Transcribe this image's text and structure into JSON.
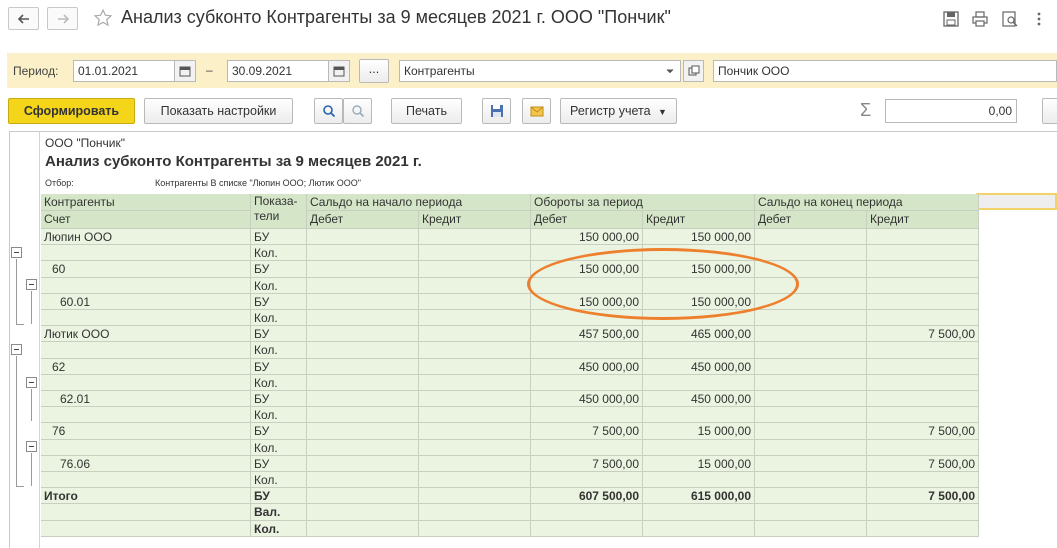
{
  "window": {
    "title": "Анализ субконто Контрагенты за 9 месяцев 2021 г. ООО \"Пончик\""
  },
  "params": {
    "period_label": "Период:",
    "date_from": "01.01.2021",
    "dash": "–",
    "date_to": "30.09.2021",
    "ellipsis": "...",
    "subconto_type": "Контрагенты",
    "organization": "Пончик ООО"
  },
  "toolbar": {
    "generate": "Сформировать",
    "show_settings": "Показать настройки",
    "print": "Печать",
    "register": "Регистр учета",
    "sum_symbol": "Σ",
    "sum_value": "0,00"
  },
  "report": {
    "org": "ООО \"Пончик\"",
    "title": "Анализ субконто Контрагенты за 9 месяцев 2021 г.",
    "filter_label": "Отбор:",
    "filter_value": "Контрагенты В списке \"Люпин ООО; Лютик ООО\"",
    "headers": {
      "contractors": "Контрагенты",
      "account": "Счет",
      "indicators": "Показа-\nтели",
      "opening": "Сальдо на начало периода",
      "turnover": "Обороты за период",
      "closing": "Сальдо на конец периода",
      "debit": "Дебет",
      "credit": "Кредит"
    },
    "rows": [
      {
        "name": "Люпин ООО",
        "ind": "БУ",
        "od": "",
        "oc": "",
        "td": "150 000,00",
        "tc": "150 000,00",
        "cd": "",
        "cc": ""
      },
      {
        "name": "",
        "ind": "Кол.",
        "od": "",
        "oc": "",
        "td": "",
        "tc": "",
        "cd": "",
        "cc": ""
      },
      {
        "name": "60",
        "ind": "БУ",
        "od": "",
        "oc": "",
        "td": "150 000,00",
        "tc": "150 000,00",
        "cd": "",
        "cc": ""
      },
      {
        "name": "",
        "ind": "Кол.",
        "od": "",
        "oc": "",
        "td": "",
        "tc": "",
        "cd": "",
        "cc": ""
      },
      {
        "name": "60.01",
        "ind": "БУ",
        "od": "",
        "oc": "",
        "td": "150 000,00",
        "tc": "150 000,00",
        "cd": "",
        "cc": ""
      },
      {
        "name": "",
        "ind": "Кол.",
        "od": "",
        "oc": "",
        "td": "",
        "tc": "",
        "cd": "",
        "cc": ""
      },
      {
        "name": "Лютик ООО",
        "ind": "БУ",
        "od": "",
        "oc": "",
        "td": "457 500,00",
        "tc": "465 000,00",
        "cd": "",
        "cc": "7 500,00"
      },
      {
        "name": "",
        "ind": "Кол.",
        "od": "",
        "oc": "",
        "td": "",
        "tc": "",
        "cd": "",
        "cc": ""
      },
      {
        "name": "62",
        "ind": "БУ",
        "od": "",
        "oc": "",
        "td": "450 000,00",
        "tc": "450 000,00",
        "cd": "",
        "cc": ""
      },
      {
        "name": "",
        "ind": "Кол.",
        "od": "",
        "oc": "",
        "td": "",
        "tc": "",
        "cd": "",
        "cc": ""
      },
      {
        "name": "62.01",
        "ind": "БУ",
        "od": "",
        "oc": "",
        "td": "450 000,00",
        "tc": "450 000,00",
        "cd": "",
        "cc": ""
      },
      {
        "name": "",
        "ind": "Кол.",
        "od": "",
        "oc": "",
        "td": "",
        "tc": "",
        "cd": "",
        "cc": ""
      },
      {
        "name": "76",
        "ind": "БУ",
        "od": "",
        "oc": "",
        "td": "7 500,00",
        "tc": "15 000,00",
        "cd": "",
        "cc": "7 500,00"
      },
      {
        "name": "",
        "ind": "Кол.",
        "od": "",
        "oc": "",
        "td": "",
        "tc": "",
        "cd": "",
        "cc": ""
      },
      {
        "name": "76.06",
        "ind": "БУ",
        "od": "",
        "oc": "",
        "td": "7 500,00",
        "tc": "15 000,00",
        "cd": "",
        "cc": "7 500,00"
      },
      {
        "name": "",
        "ind": "Кол.",
        "od": "",
        "oc": "",
        "td": "",
        "tc": "",
        "cd": "",
        "cc": ""
      },
      {
        "name": "Итого",
        "ind": "БУ",
        "od": "",
        "oc": "",
        "td": "607 500,00",
        "tc": "615 000,00",
        "cd": "",
        "cc": "7 500,00"
      },
      {
        "name": "",
        "ind": "Вал.",
        "od": "",
        "oc": "",
        "td": "",
        "tc": "",
        "cd": "",
        "cc": ""
      },
      {
        "name": "",
        "ind": "Кол.",
        "od": "",
        "oc": "",
        "td": "",
        "tc": "",
        "cd": "",
        "cc": ""
      }
    ]
  },
  "colors": {
    "accent_button": "#f5d51a",
    "param_bar": "#fbf0c8",
    "table_header": "#d4e6c7",
    "table_body": "#eaf4e1",
    "annotation": "#ee7f2d"
  }
}
